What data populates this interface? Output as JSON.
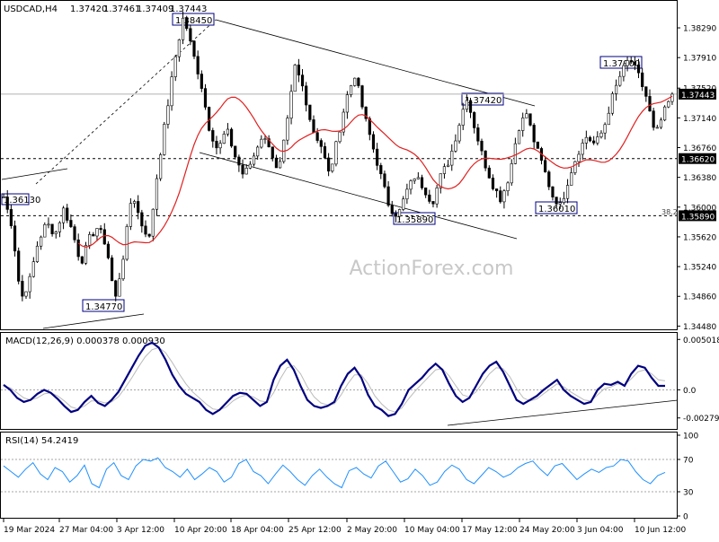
{
  "chart_data": {
    "type": "candlestick",
    "header": {
      "symbol": "USDCAD,H4",
      "ohlc": [
        "1.37420",
        "1.37461",
        "1.37409",
        "1.37443"
      ]
    },
    "watermark": "ActionForex.com",
    "x_tick_labels": [
      "19 Mar 2024",
      "27 Mar 04:00",
      "3 Apr 12:00",
      "10 Apr 20:00",
      "18 Apr 04:00",
      "25 Apr 12:00",
      "2 May 20:00",
      "10 May 04:00",
      "17 May 12:00",
      "24 May 20:00",
      "3 Jun 04:00",
      "10 Jun 12:00"
    ],
    "price_panel": {
      "ylim": [
        1.3445,
        1.386
      ],
      "y_tick_labels": [
        "1.38290",
        "1.37910",
        "1.37520",
        "1.37140",
        "1.36760",
        "1.36380",
        "1.36000",
        "1.35620",
        "1.35240",
        "1.34860",
        "1.34480"
      ],
      "current_price_label": "1.37443",
      "current_price": 1.37443,
      "horizontal_levels": [
        {
          "value": 1.3662,
          "label": "1.36620",
          "style": "dashed"
        },
        {
          "value": 1.3589,
          "label": "1.35890",
          "style": "dashed"
        }
      ],
      "fib_label": "38.2",
      "price_annotations": [
        {
          "text": "1.36130",
          "value": 1.3613
        },
        {
          "text": "1.34770",
          "value": 1.3477
        },
        {
          "text": "1.38450",
          "value": 1.3845
        },
        {
          "text": "1.35890",
          "value": 1.3589
        },
        {
          "text": "1.37420",
          "value": 1.3742
        },
        {
          "text": "1.37900",
          "value": 1.379
        },
        {
          "text": "1.36010",
          "value": 1.3601
        }
      ],
      "close_path": [
        1.3613,
        1.3575,
        1.3482,
        1.3505,
        1.3555,
        1.358,
        1.3565,
        1.3598,
        1.357,
        1.3528,
        1.356,
        1.3575,
        1.355,
        1.348,
        1.354,
        1.362,
        1.358,
        1.356,
        1.365,
        1.372,
        1.379,
        1.3845,
        1.38,
        1.376,
        1.37,
        1.3672,
        1.37,
        1.3665,
        1.364,
        1.366,
        1.369,
        1.368,
        1.364,
        1.37,
        1.378,
        1.375,
        1.37,
        1.368,
        1.364,
        1.369,
        1.374,
        1.377,
        1.372,
        1.368,
        1.364,
        1.36,
        1.3589,
        1.362,
        1.364,
        1.3625,
        1.3605,
        1.364,
        1.366,
        1.37,
        1.3742,
        1.37,
        1.366,
        1.363,
        1.361,
        1.364,
        1.37,
        1.372,
        1.368,
        1.365,
        1.3615,
        1.3601,
        1.364,
        1.367,
        1.369,
        1.368,
        1.37,
        1.374,
        1.377,
        1.379,
        1.377,
        1.374,
        1.369,
        1.372,
        1.3744
      ]
    },
    "macd_panel": {
      "label": "MACD(12,26,9) 0.000378 0.000930",
      "y_tick_labels": [
        "0.005018",
        "0.0",
        "-0.002795"
      ],
      "ylim": [
        -0.0038,
        0.0054
      ],
      "main_path": [
        0.0005,
        0.0,
        -0.0008,
        -0.0012,
        -0.001,
        -0.0004,
        0.0,
        -0.0003,
        -0.0009,
        -0.0016,
        -0.0022,
        -0.002,
        -0.0012,
        -0.0006,
        -0.0013,
        -0.0016,
        -0.001,
        -0.0002,
        0.001,
        0.0022,
        0.0034,
        0.0044,
        0.0047,
        0.0042,
        0.003,
        0.0015,
        0.0004,
        -0.0004,
        -0.0008,
        -0.0012,
        -0.002,
        -0.0024,
        -0.002,
        -0.0013,
        -0.0006,
        -0.0003,
        -0.0004,
        -0.001,
        -0.0016,
        -0.0012,
        0.001,
        0.0024,
        0.003,
        0.002,
        0.0004,
        -0.001,
        -0.0016,
        -0.0018,
        -0.0016,
        -0.0012,
        0.0004,
        0.0016,
        0.0022,
        0.0012,
        -0.0005,
        -0.0016,
        -0.002,
        -0.0026,
        -0.0024,
        -0.0014,
        0.0,
        0.0006,
        0.0012,
        0.002,
        0.0026,
        0.002,
        0.0006,
        -0.0006,
        -0.0012,
        -0.0008,
        0.0004,
        0.0016,
        0.0024,
        0.0028,
        0.0018,
        0.0004,
        -0.001,
        -0.0014,
        -0.001,
        -0.0006,
        0.0,
        0.0005,
        0.001,
        0.0,
        -0.0006,
        -0.001,
        -0.0014,
        -0.0012,
        0.0,
        0.0006,
        0.0005,
        0.0008,
        0.0004,
        0.0016,
        0.0024,
        0.0022,
        0.0012,
        0.0004,
        0.0004
      ],
      "signal_path": [
        0.0004,
        0.0002,
        -0.0003,
        -0.0008,
        -0.001,
        -0.0008,
        -0.0004,
        -0.0003,
        -0.0006,
        -0.0011,
        -0.0017,
        -0.0019,
        -0.0016,
        -0.0011,
        -0.0011,
        -0.0013,
        -0.0012,
        -0.0007,
        0.0002,
        0.0012,
        0.0023,
        0.0033,
        0.004,
        0.0042,
        0.0037,
        0.0027,
        0.0016,
        0.0006,
        -0.0002,
        -0.0008,
        -0.0014,
        -0.0019,
        -0.002,
        -0.0017,
        -0.0011,
        -0.0007,
        -0.0005,
        -0.0007,
        -0.0011,
        -0.0012,
        -0.0003,
        0.0011,
        0.0022,
        0.0024,
        0.0016,
        0.0003,
        -0.0007,
        -0.0013,
        -0.0015,
        -0.0014,
        -0.0005,
        0.0006,
        0.0015,
        0.0015,
        0.0006,
        -0.0006,
        -0.0014,
        -0.002,
        -0.0022,
        -0.0018,
        -0.0009,
        -0.0001,
        0.0006,
        0.0013,
        0.002,
        0.0021,
        0.0014,
        0.0004,
        -0.0005,
        -0.0007,
        -0.0002,
        0.0007,
        0.0016,
        0.0022,
        0.0021,
        0.0013,
        0.0001,
        -0.0008,
        -0.0011,
        -0.0009,
        -0.0004,
        0.0001,
        0.0006,
        0.0003,
        -0.0002,
        -0.0006,
        -0.001,
        -0.0011,
        -0.0005,
        0.0001,
        0.0003,
        0.0006,
        0.0005,
        0.0011,
        0.0018,
        0.002,
        0.0016,
        0.001,
        0.0009
      ]
    },
    "rsi_panel": {
      "label": "RSI(14) 54.2419",
      "y_tick_labels": [
        "100",
        "70",
        "30",
        "0"
      ],
      "ylim": [
        0,
        100
      ],
      "levels": [
        70,
        30
      ],
      "path": [
        62,
        55,
        48,
        58,
        66,
        52,
        45,
        60,
        55,
        42,
        50,
        63,
        40,
        35,
        58,
        66,
        50,
        45,
        62,
        70,
        68,
        72,
        60,
        55,
        48,
        58,
        45,
        52,
        60,
        55,
        42,
        48,
        65,
        70,
        55,
        50,
        40,
        52,
        63,
        55,
        45,
        38,
        50,
        58,
        48,
        40,
        35,
        56,
        60,
        52,
        47,
        62,
        68,
        55,
        42,
        46,
        58,
        50,
        38,
        42,
        55,
        63,
        58,
        45,
        40,
        50,
        60,
        55,
        48,
        52,
        60,
        65,
        68,
        58,
        50,
        62,
        65,
        55,
        45,
        52,
        58,
        54,
        60,
        62,
        70,
        68,
        55,
        45,
        40,
        50,
        54
      ]
    }
  }
}
